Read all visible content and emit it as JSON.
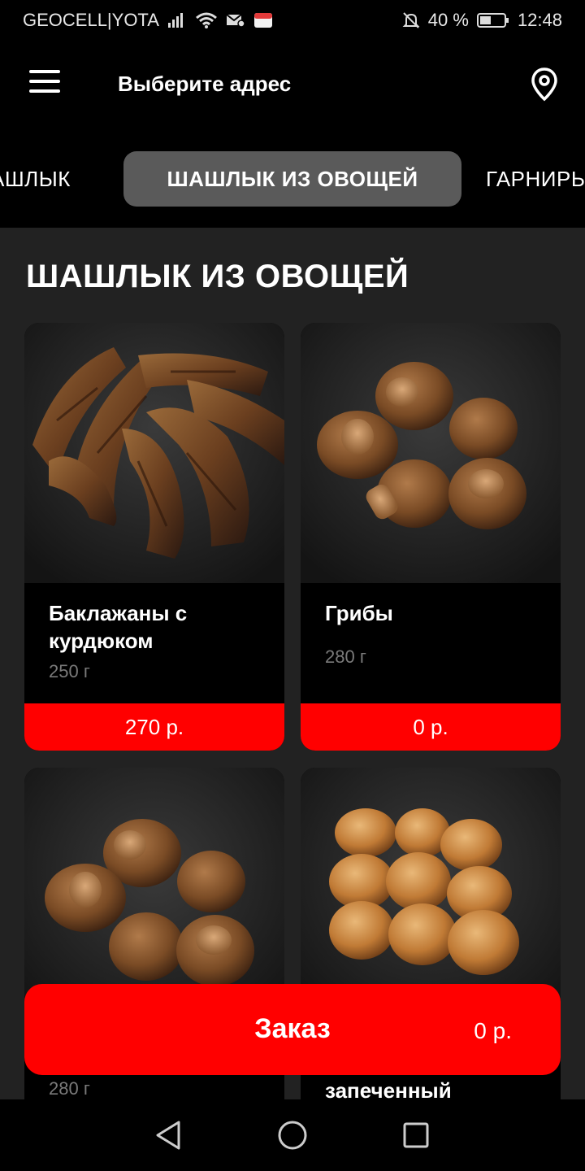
{
  "status_bar": {
    "carrier": "GEOCELL|YOTA",
    "battery": "40 %",
    "time": "12:48",
    "icons": [
      "signal-icon",
      "wifi-icon",
      "notification-icon",
      "app-icon",
      "mute-icon",
      "battery-icon"
    ]
  },
  "header": {
    "title": "Выберите адрес",
    "menu_icon": "hamburger-menu-icon",
    "location_icon": "location-pin-icon"
  },
  "tabs": [
    {
      "label": "АШЛЫК",
      "active": false
    },
    {
      "label": "ШАШЛЫК ИЗ ОВОЩЕЙ",
      "active": true
    },
    {
      "label": "ГАРНИРЫ",
      "active": false
    }
  ],
  "section": {
    "title": "ШАШЛЫК ИЗ ОВОЩЕЙ"
  },
  "products": [
    {
      "name": "Баклажаны с курдюком",
      "weight": "250 г",
      "price": "270 р.",
      "image": "eggplant-image"
    },
    {
      "name": "Грибы",
      "weight": "280 г",
      "price": "0 р.",
      "image": "mushroom-image"
    },
    {
      "name": "",
      "weight": "280 г",
      "price": "",
      "image": "mushroom-image"
    },
    {
      "name": "запеченный",
      "weight": "",
      "price": "",
      "image": "potato-image"
    }
  ],
  "order": {
    "label": "Заказ",
    "total": "0 р."
  },
  "nav": {
    "icons": [
      "back-icon",
      "home-icon",
      "recents-icon"
    ]
  },
  "colors": {
    "accent": "#ff0000",
    "background": "#222222",
    "header": "#000000",
    "active_tab": "#5a5a5a",
    "muted_text": "#7a7a7a"
  }
}
